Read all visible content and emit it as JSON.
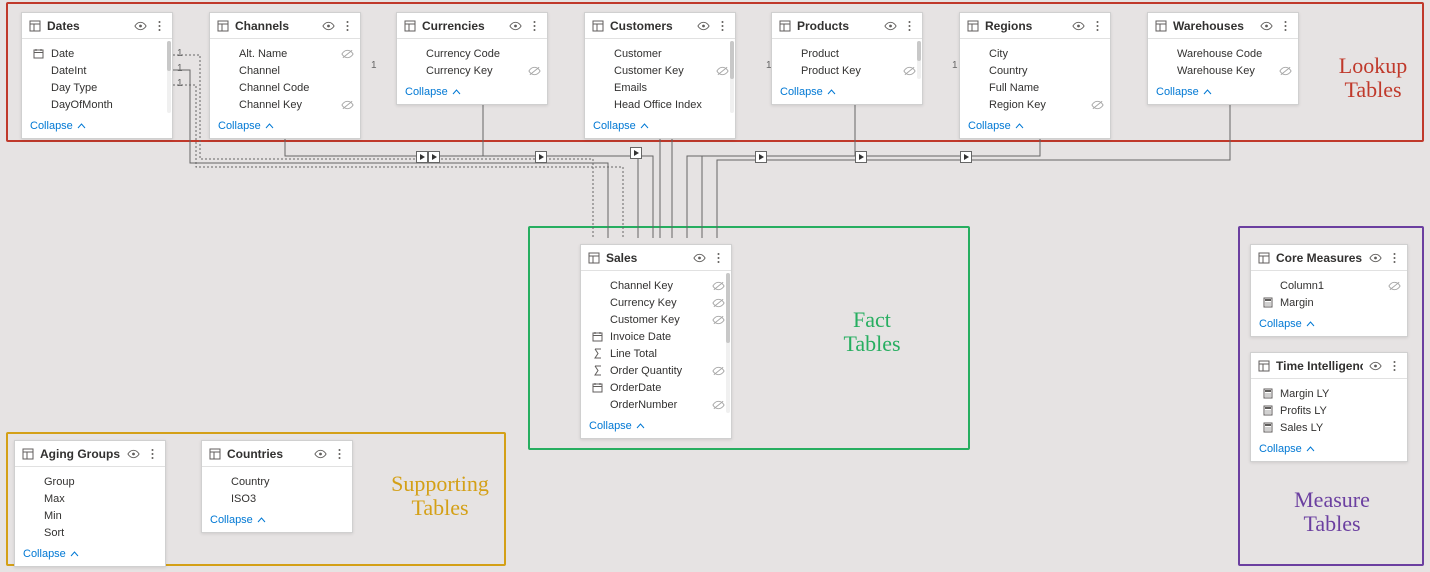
{
  "groups": {
    "lookup": {
      "label_line1": "Lookup",
      "label_line2": "Tables"
    },
    "fact": {
      "label_line1": "Fact",
      "label_line2": "Tables"
    },
    "support": {
      "label_line1": "Supporting",
      "label_line2": "Tables"
    },
    "measure": {
      "label_line1": "Measure",
      "label_line2": "Tables"
    }
  },
  "collapse_label": "Collapse",
  "tables": {
    "dates": {
      "title": "Dates",
      "fields": [
        "Date",
        "DateInt",
        "Day Type",
        "DayOfMonth"
      ],
      "icons": [
        "date",
        "",
        "",
        ""
      ],
      "hidden": [
        false,
        false,
        false,
        false
      ]
    },
    "channels": {
      "title": "Channels",
      "fields": [
        "Alt. Name",
        "Channel",
        "Channel Code",
        "Channel Key"
      ],
      "icons": [
        "",
        "",
        "",
        ""
      ],
      "hidden": [
        true,
        false,
        false,
        true
      ]
    },
    "currencies": {
      "title": "Currencies",
      "fields": [
        "Currency Code",
        "Currency Key"
      ],
      "icons": [
        "",
        ""
      ],
      "hidden": [
        false,
        true
      ]
    },
    "customers": {
      "title": "Customers",
      "fields": [
        "Customer",
        "Customer Key",
        "Emails",
        "Head Office Index"
      ],
      "icons": [
        "",
        "",
        "",
        ""
      ],
      "hidden": [
        false,
        true,
        false,
        false
      ]
    },
    "products": {
      "title": "Products",
      "fields": [
        "Product",
        "Product Key"
      ],
      "icons": [
        "",
        ""
      ],
      "hidden": [
        false,
        true
      ]
    },
    "regions": {
      "title": "Regions",
      "fields": [
        "City",
        "Country",
        "Full Name",
        "Region Key"
      ],
      "icons": [
        "",
        "",
        "",
        ""
      ],
      "hidden": [
        false,
        false,
        false,
        true
      ]
    },
    "warehouses": {
      "title": "Warehouses",
      "fields": [
        "Warehouse Code",
        "Warehouse Key"
      ],
      "icons": [
        "",
        ""
      ],
      "hidden": [
        false,
        true
      ]
    },
    "sales": {
      "title": "Sales",
      "fields": [
        "Channel Key",
        "Currency Key",
        "Customer Key",
        "Invoice Date",
        "Line Total",
        "Order Quantity",
        "OrderDate",
        "OrderNumber"
      ],
      "icons": [
        "",
        "",
        "",
        "date",
        "sigma",
        "sigma",
        "date",
        ""
      ],
      "hidden": [
        true,
        true,
        true,
        false,
        false,
        true,
        false,
        true
      ]
    },
    "aging": {
      "title": "Aging Groups",
      "fields": [
        "Group",
        "Max",
        "Min",
        "Sort"
      ],
      "icons": [
        "",
        "",
        "",
        ""
      ],
      "hidden": [
        false,
        false,
        false,
        false
      ]
    },
    "countries": {
      "title": "Countries",
      "fields": [
        "Country",
        "ISO3"
      ],
      "icons": [
        "",
        ""
      ],
      "hidden": [
        false,
        false
      ]
    },
    "core": {
      "title": "Core Measures",
      "fields": [
        "Column1",
        "Margin"
      ],
      "icons": [
        "",
        "calc"
      ],
      "hidden": [
        true,
        false
      ]
    },
    "ti": {
      "title": "Time Intelligence",
      "fields": [
        "Margin LY",
        "Profits LY",
        "Sales LY"
      ],
      "icons": [
        "calc",
        "calc",
        "calc"
      ],
      "hidden": [
        false,
        false,
        false
      ]
    }
  }
}
